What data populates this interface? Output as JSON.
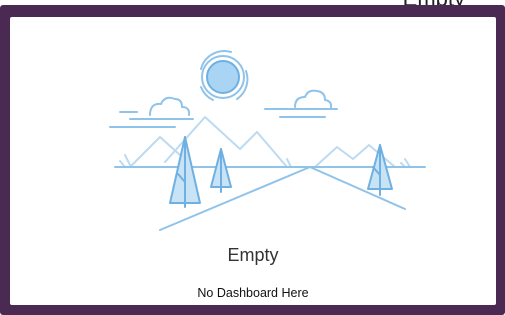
{
  "header": {
    "clipped_title": "Empty"
  },
  "empty_state": {
    "title": "Empty",
    "message": "No Dashboard Here",
    "illustration": "landscape-illustration"
  },
  "colors": {
    "frame": "#4a2a52",
    "card_background": "#ffffff",
    "illustration_stroke": "#8fc3ea",
    "illustration_fill": "#c9e3f6",
    "sun_fill": "#a9d4f3"
  }
}
